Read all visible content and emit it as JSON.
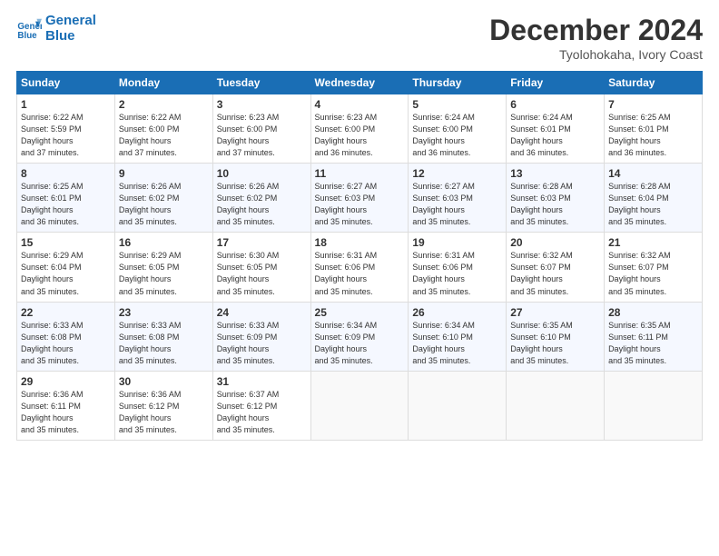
{
  "logo": {
    "line1": "General",
    "line2": "Blue"
  },
  "title": "December 2024",
  "subtitle": "Tyolohokaha, Ivory Coast",
  "days_of_week": [
    "Sunday",
    "Monday",
    "Tuesday",
    "Wednesday",
    "Thursday",
    "Friday",
    "Saturday"
  ],
  "weeks": [
    [
      {
        "day": 1,
        "sunrise": "6:22 AM",
        "sunset": "5:59 PM",
        "daylight": "11 hours and 37 minutes."
      },
      {
        "day": 2,
        "sunrise": "6:22 AM",
        "sunset": "6:00 PM",
        "daylight": "11 hours and 37 minutes."
      },
      {
        "day": 3,
        "sunrise": "6:23 AM",
        "sunset": "6:00 PM",
        "daylight": "11 hours and 37 minutes."
      },
      {
        "day": 4,
        "sunrise": "6:23 AM",
        "sunset": "6:00 PM",
        "daylight": "11 hours and 36 minutes."
      },
      {
        "day": 5,
        "sunrise": "6:24 AM",
        "sunset": "6:00 PM",
        "daylight": "11 hours and 36 minutes."
      },
      {
        "day": 6,
        "sunrise": "6:24 AM",
        "sunset": "6:01 PM",
        "daylight": "11 hours and 36 minutes."
      },
      {
        "day": 7,
        "sunrise": "6:25 AM",
        "sunset": "6:01 PM",
        "daylight": "11 hours and 36 minutes."
      }
    ],
    [
      {
        "day": 8,
        "sunrise": "6:25 AM",
        "sunset": "6:01 PM",
        "daylight": "11 hours and 36 minutes."
      },
      {
        "day": 9,
        "sunrise": "6:26 AM",
        "sunset": "6:02 PM",
        "daylight": "11 hours and 35 minutes."
      },
      {
        "day": 10,
        "sunrise": "6:26 AM",
        "sunset": "6:02 PM",
        "daylight": "11 hours and 35 minutes."
      },
      {
        "day": 11,
        "sunrise": "6:27 AM",
        "sunset": "6:03 PM",
        "daylight": "11 hours and 35 minutes."
      },
      {
        "day": 12,
        "sunrise": "6:27 AM",
        "sunset": "6:03 PM",
        "daylight": "11 hours and 35 minutes."
      },
      {
        "day": 13,
        "sunrise": "6:28 AM",
        "sunset": "6:03 PM",
        "daylight": "11 hours and 35 minutes."
      },
      {
        "day": 14,
        "sunrise": "6:28 AM",
        "sunset": "6:04 PM",
        "daylight": "11 hours and 35 minutes."
      }
    ],
    [
      {
        "day": 15,
        "sunrise": "6:29 AM",
        "sunset": "6:04 PM",
        "daylight": "11 hours and 35 minutes."
      },
      {
        "day": 16,
        "sunrise": "6:29 AM",
        "sunset": "6:05 PM",
        "daylight": "11 hours and 35 minutes."
      },
      {
        "day": 17,
        "sunrise": "6:30 AM",
        "sunset": "6:05 PM",
        "daylight": "11 hours and 35 minutes."
      },
      {
        "day": 18,
        "sunrise": "6:31 AM",
        "sunset": "6:06 PM",
        "daylight": "11 hours and 35 minutes."
      },
      {
        "day": 19,
        "sunrise": "6:31 AM",
        "sunset": "6:06 PM",
        "daylight": "11 hours and 35 minutes."
      },
      {
        "day": 20,
        "sunrise": "6:32 AM",
        "sunset": "6:07 PM",
        "daylight": "11 hours and 35 minutes."
      },
      {
        "day": 21,
        "sunrise": "6:32 AM",
        "sunset": "6:07 PM",
        "daylight": "11 hours and 35 minutes."
      }
    ],
    [
      {
        "day": 22,
        "sunrise": "6:33 AM",
        "sunset": "6:08 PM",
        "daylight": "11 hours and 35 minutes."
      },
      {
        "day": 23,
        "sunrise": "6:33 AM",
        "sunset": "6:08 PM",
        "daylight": "11 hours and 35 minutes."
      },
      {
        "day": 24,
        "sunrise": "6:33 AM",
        "sunset": "6:09 PM",
        "daylight": "11 hours and 35 minutes."
      },
      {
        "day": 25,
        "sunrise": "6:34 AM",
        "sunset": "6:09 PM",
        "daylight": "11 hours and 35 minutes."
      },
      {
        "day": 26,
        "sunrise": "6:34 AM",
        "sunset": "6:10 PM",
        "daylight": "11 hours and 35 minutes."
      },
      {
        "day": 27,
        "sunrise": "6:35 AM",
        "sunset": "6:10 PM",
        "daylight": "11 hours and 35 minutes."
      },
      {
        "day": 28,
        "sunrise": "6:35 AM",
        "sunset": "6:11 PM",
        "daylight": "11 hours and 35 minutes."
      }
    ],
    [
      {
        "day": 29,
        "sunrise": "6:36 AM",
        "sunset": "6:11 PM",
        "daylight": "11 hours and 35 minutes."
      },
      {
        "day": 30,
        "sunrise": "6:36 AM",
        "sunset": "6:12 PM",
        "daylight": "11 hours and 35 minutes."
      },
      {
        "day": 31,
        "sunrise": "6:37 AM",
        "sunset": "6:12 PM",
        "daylight": "11 hours and 35 minutes."
      },
      null,
      null,
      null,
      null
    ]
  ]
}
